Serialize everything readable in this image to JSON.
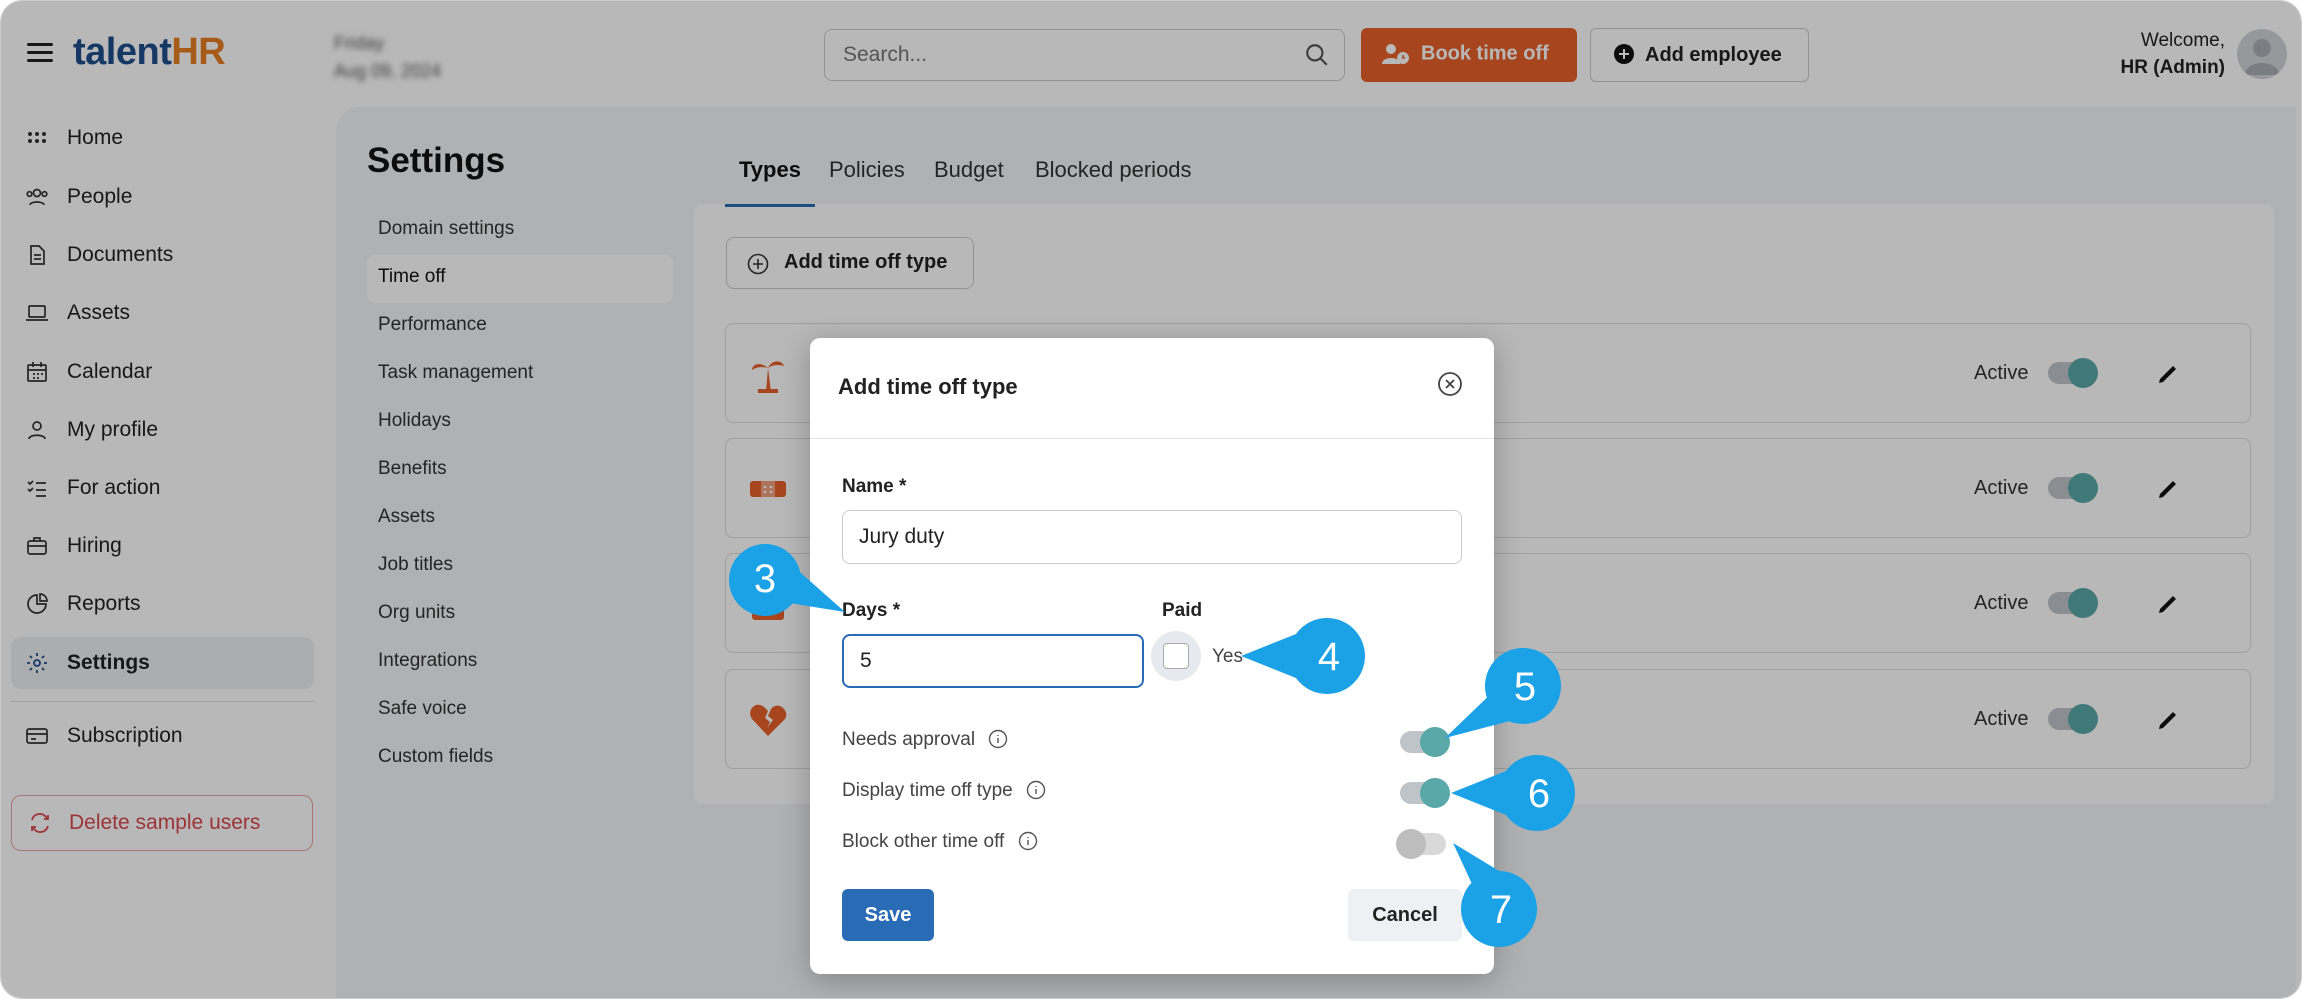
{
  "app": {
    "logo_main": "talent",
    "logo_accent": "HR"
  },
  "header": {
    "date_day": "Friday",
    "date_full": "Aug 09, 2024",
    "search_placeholder": "Search...",
    "book_time_off": "Book time off",
    "add_employee": "Add employee",
    "welcome": "Welcome,",
    "user": "HR (Admin)"
  },
  "sidebar": {
    "items": [
      {
        "label": "Home",
        "icon": "grid-icon"
      },
      {
        "label": "People",
        "icon": "people-icon"
      },
      {
        "label": "Documents",
        "icon": "document-icon"
      },
      {
        "label": "Assets",
        "icon": "laptop-icon"
      },
      {
        "label": "Calendar",
        "icon": "calendar-icon"
      },
      {
        "label": "My profile",
        "icon": "user-icon"
      },
      {
        "label": "For action",
        "icon": "checklist-icon"
      },
      {
        "label": "Hiring",
        "icon": "briefcase-icon"
      },
      {
        "label": "Reports",
        "icon": "pie-chart-icon"
      },
      {
        "label": "Settings",
        "icon": "gear-icon"
      }
    ],
    "subscription": "Subscription",
    "delete_sample": "Delete sample users"
  },
  "settings": {
    "title": "Settings",
    "menu": [
      "Domain settings",
      "Time off",
      "Performance",
      "Task management",
      "Holidays",
      "Benefits",
      "Assets",
      "Job titles",
      "Org units",
      "Integrations",
      "Safe voice",
      "Custom fields"
    ],
    "tabs": [
      "Types",
      "Policies",
      "Budget",
      "Blocked periods"
    ],
    "add_type": "Add time off type",
    "row_status": "Active"
  },
  "modal": {
    "title": "Add time off type",
    "name_label": "Name *",
    "name_value": "Jury duty",
    "days_label": "Days *",
    "days_value": "5",
    "paid_label": "Paid",
    "paid_yes": "Yes",
    "needs_approval": "Needs approval",
    "display_type": "Display time off type",
    "block_other": "Block other time off",
    "save": "Save",
    "cancel": "Cancel"
  },
  "callouts": [
    "3",
    "4",
    "5",
    "6",
    "7"
  ],
  "colors": {
    "brand_blue": "#1f4e8c",
    "brand_orange": "#e8622a",
    "primary": "#2a6bb5",
    "callout": "#1aa1e6",
    "toggle_on": "#5aa8a8"
  }
}
